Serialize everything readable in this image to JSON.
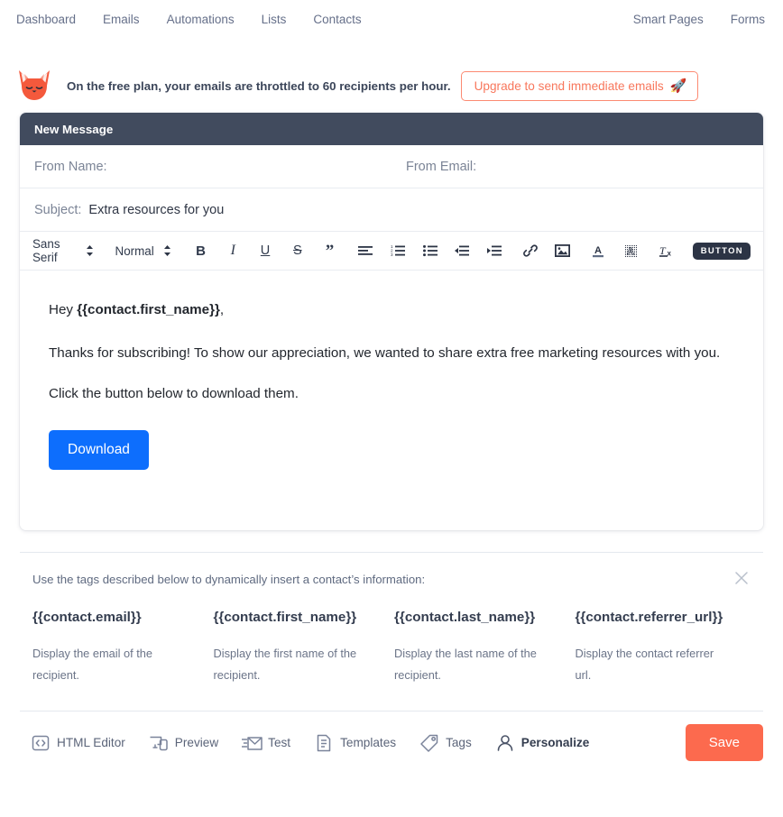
{
  "nav": {
    "left": [
      {
        "label": "Dashboard",
        "name": "nav-dashboard"
      },
      {
        "label": "Emails",
        "name": "nav-emails"
      },
      {
        "label": "Automations",
        "name": "nav-automations"
      },
      {
        "label": "Lists",
        "name": "nav-lists"
      },
      {
        "label": "Contacts",
        "name": "nav-contacts"
      }
    ],
    "right": [
      {
        "label": "Smart Pages",
        "name": "nav-smart-pages"
      },
      {
        "label": "Forms",
        "name": "nav-forms"
      }
    ]
  },
  "banner": {
    "logo_icon": "fox-logo-icon",
    "message": "On the free plan, your emails are throttled to 60 recipients per hour.",
    "upgrade_label": "Upgrade to send immediate emails",
    "upgrade_icon": "rocket-icon",
    "upgrade_glyph": "🚀",
    "accent_color": "#f8775c"
  },
  "composer": {
    "title": "New Message",
    "header_bg": "#414b5e",
    "from_name_label": "From Name:",
    "from_name_value": "",
    "from_email_label": "From Email:",
    "from_email_value": "",
    "subject_label": "Subject:",
    "subject_value": "Extra resources for you"
  },
  "toolbar": {
    "font_family": "Sans Serif",
    "font_size": "Normal",
    "buttons": [
      {
        "name": "bold-button",
        "label": "B"
      },
      {
        "name": "italic-button",
        "label": "I"
      },
      {
        "name": "underline-button",
        "label": "U"
      },
      {
        "name": "strikethrough-button",
        "label": "S"
      },
      {
        "name": "blockquote-button",
        "label": "”"
      }
    ],
    "icon_buttons": [
      {
        "name": "align-icon"
      },
      {
        "name": "ordered-list-icon"
      },
      {
        "name": "bullet-list-icon"
      },
      {
        "name": "outdent-icon"
      },
      {
        "name": "indent-icon"
      },
      {
        "name": "link-icon"
      },
      {
        "name": "image-icon"
      },
      {
        "name": "text-color-icon"
      },
      {
        "name": "highlight-color-icon"
      },
      {
        "name": "clear-format-icon"
      }
    ],
    "insert_button_label": "BUTTON"
  },
  "body": {
    "greeting_prefix": "Hey ",
    "greeting_merge_tag": "{{contact.first_name}}",
    "greeting_suffix": ",",
    "paragraph_1": "Thanks for subscribing! To show our appreciation, we wanted to share extra free marketing resources with you.",
    "paragraph_2": "Click the button below to download them.",
    "cta_label": "Download",
    "cta_color": "#0d6efd"
  },
  "tags_panel": {
    "intro": "Use the tags described below to dynamically insert a contact’s information:",
    "close_icon": "close-icon",
    "tags": [
      {
        "name": "{{contact.email}}",
        "desc": "Display the email of the recipient."
      },
      {
        "name": "{{contact.first_name}}",
        "desc": "Display the first name of the recipient."
      },
      {
        "name": "{{contact.last_name}}",
        "desc": "Display the last name of the recipient."
      },
      {
        "name": "{{contact.referrer_url}}",
        "desc": "Display the contact referrer url."
      }
    ]
  },
  "bottombar": {
    "items": [
      {
        "label": "HTML Editor",
        "icon": "code-brackets-icon",
        "active": false
      },
      {
        "label": "Preview",
        "icon": "devices-preview-icon",
        "active": false
      },
      {
        "label": "Test",
        "icon": "send-envelope-icon",
        "active": false
      },
      {
        "label": "Templates",
        "icon": "document-icon",
        "active": false
      },
      {
        "label": "Tags",
        "icon": "tag-icon",
        "active": false
      },
      {
        "label": "Personalize",
        "icon": "person-icon",
        "active": true
      }
    ],
    "save_label": "Save",
    "save_color": "#fc6a4e"
  }
}
